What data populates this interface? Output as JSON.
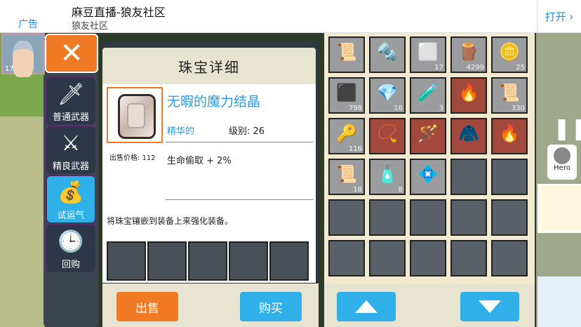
{
  "ad": {
    "tag": "广告",
    "title": "麻豆直播-狼友社区",
    "subtitle": "狼友社区",
    "open_label": "打开 ›"
  },
  "hero": {
    "level": "17"
  },
  "close_label": "✕",
  "tabs": [
    {
      "label": "普通武器",
      "icon": "sword-icon",
      "glyph": "🗡"
    },
    {
      "label": "精良武器",
      "icon": "fine-sword-icon",
      "glyph": "⚔"
    },
    {
      "label": "试运气",
      "icon": "lucky-bag-icon",
      "glyph": "💰",
      "active": true
    },
    {
      "label": "回购",
      "icon": "clock-icon",
      "glyph": "🕒"
    }
  ],
  "detail": {
    "title": "珠宝详细",
    "item_name": "无暇的魔力结晶",
    "quality": "精华的",
    "level_label": "级别: 26",
    "price_label": "出售价格: 112",
    "stat": "生命偷取 + 2%",
    "description": "将珠宝镶嵌到装备上来强化装备。"
  },
  "buttons": {
    "sell": "出售",
    "buy": "购买"
  },
  "inventory": [
    {
      "icon": "fire-scroll-icon",
      "glyph": "📜",
      "count": "",
      "red": false
    },
    {
      "icon": "drill-icon",
      "glyph": "🔩",
      "count": "",
      "red": false
    },
    {
      "icon": "silver-ingot-icon",
      "glyph": "⬜",
      "count": "17",
      "red": false
    },
    {
      "icon": "wood-pile-icon",
      "glyph": "🪵",
      "count": "4299",
      "red": false
    },
    {
      "icon": "gold-coins-icon",
      "glyph": "🪙",
      "count": "25",
      "red": false
    },
    {
      "icon": "iron-ingot-icon",
      "glyph": "⬛",
      "count": "798",
      "red": false
    },
    {
      "icon": "red-crystal-icon",
      "glyph": "💎",
      "count": "16",
      "red": false
    },
    {
      "icon": "potion-vial-icon",
      "glyph": "🧪",
      "count": "3",
      "red": false
    },
    {
      "icon": "fire-rune-icon",
      "glyph": "🔥",
      "count": "",
      "red": true
    },
    {
      "icon": "blue-scroll-icon",
      "glyph": "📜",
      "count": "330",
      "red": false
    },
    {
      "icon": "golden-key-icon",
      "glyph": "🔑",
      "count": "116",
      "red": false
    },
    {
      "icon": "amulet-icon",
      "glyph": "📿",
      "count": "",
      "red": true
    },
    {
      "icon": "magic-staff-icon",
      "glyph": "🪄",
      "count": "",
      "red": true
    },
    {
      "icon": "blue-cloak-icon",
      "glyph": "🧥",
      "count": "",
      "red": true
    },
    {
      "icon": "fire-rune-icon",
      "glyph": "🔥",
      "count": "",
      "red": true
    },
    {
      "icon": "red-scroll-icon",
      "glyph": "📜",
      "count": "18",
      "red": false
    },
    {
      "icon": "health-potion-icon",
      "glyph": "🧴",
      "count": "8",
      "red": false
    },
    {
      "icon": "gem-icon",
      "glyph": "💠",
      "count": "",
      "red": false
    },
    {
      "icon": "",
      "glyph": "",
      "count": "",
      "empty": true
    },
    {
      "icon": "",
      "glyph": "",
      "count": "",
      "empty": true
    },
    {
      "icon": "",
      "glyph": "",
      "count": "",
      "empty": true
    },
    {
      "icon": "",
      "glyph": "",
      "count": "",
      "empty": true
    },
    {
      "icon": "",
      "glyph": "",
      "count": "",
      "empty": true
    },
    {
      "icon": "",
      "glyph": "",
      "count": "",
      "empty": true
    },
    {
      "icon": "",
      "glyph": "",
      "count": "",
      "empty": true
    },
    {
      "icon": "",
      "glyph": "",
      "count": "",
      "empty": true
    },
    {
      "icon": "",
      "glyph": "",
      "count": "",
      "empty": true
    },
    {
      "icon": "",
      "glyph": "",
      "count": "",
      "empty": true
    },
    {
      "icon": "",
      "glyph": "",
      "count": "",
      "empty": true
    },
    {
      "icon": "",
      "glyph": "",
      "count": "",
      "empty": true
    }
  ],
  "hud": {
    "pause": "❚❚",
    "hero_label": "Hero"
  }
}
